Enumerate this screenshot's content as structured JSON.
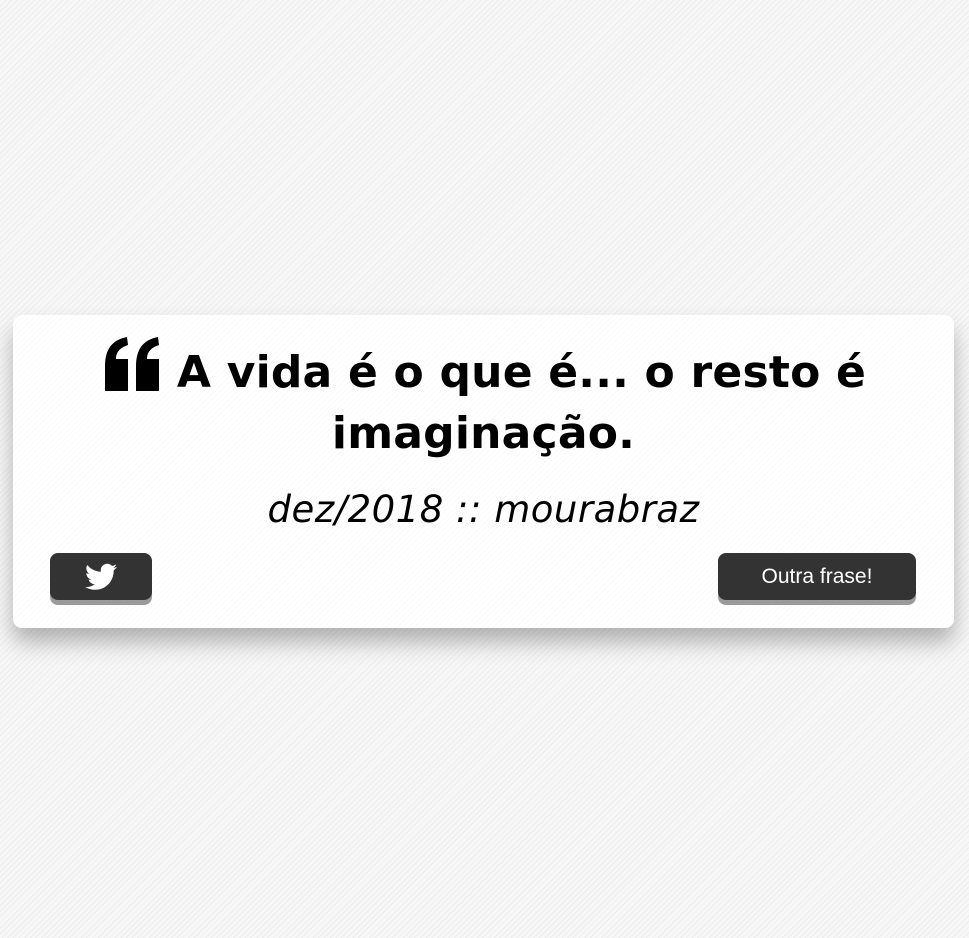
{
  "quote": {
    "icon": "quote-left-icon",
    "text": "A vida é o que é... o resto é imaginação.",
    "author": "dez/2018 :: mourabraz"
  },
  "actions": {
    "tweet_icon": "twitter-icon",
    "new_quote_label": "Outra frase!"
  },
  "colors": {
    "button_bg": "#333333",
    "button_text": "#ffffff",
    "card_bg": "#ffffff",
    "text": "#000000"
  }
}
